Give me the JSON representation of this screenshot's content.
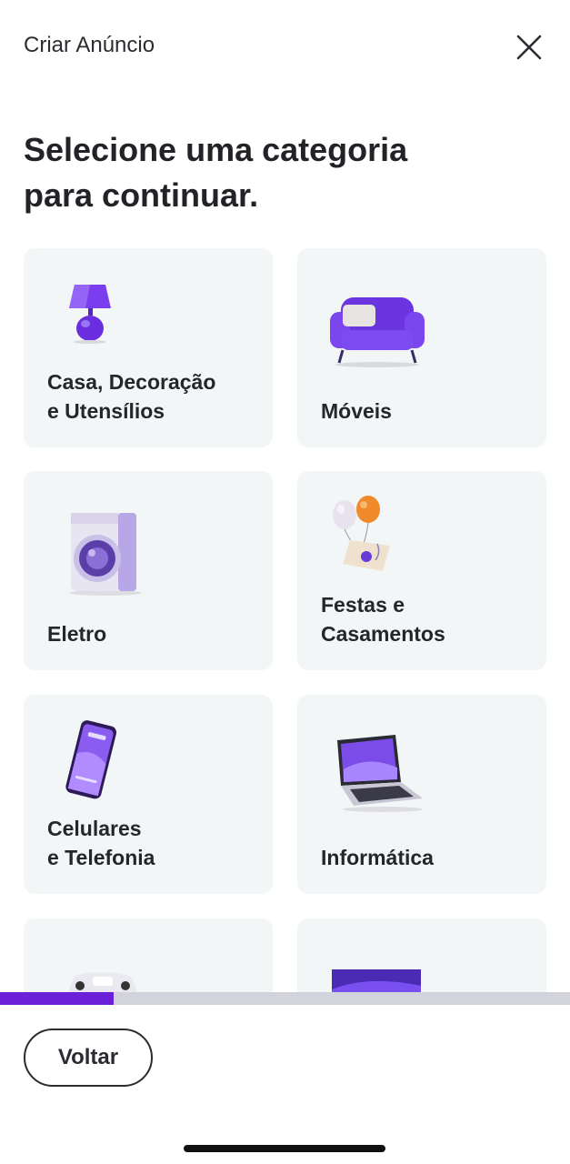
{
  "header": {
    "title": "Criar Anúncio"
  },
  "heading": {
    "line1": "Selecione uma categoria",
    "line2": "para continuar."
  },
  "categories": [
    {
      "line1": "Casa, Decoração",
      "line2": "e Utensílios",
      "icon": "lamp-icon"
    },
    {
      "line1": "Móveis",
      "line2": "",
      "icon": "armchair-icon"
    },
    {
      "line1": "Eletro",
      "line2": "",
      "icon": "washing-machine-icon"
    },
    {
      "line1": "Festas e",
      "line2": "Casamentos",
      "icon": "balloons-icon"
    },
    {
      "line1": "Celulares",
      "line2": "e Telefonia",
      "icon": "smartphone-icon"
    },
    {
      "line1": "Informática",
      "line2": "",
      "icon": "laptop-icon"
    },
    {
      "line1": "",
      "line2": "",
      "icon": "game-controller-icon"
    },
    {
      "line1": "",
      "line2": "",
      "icon": "tv-icon"
    }
  ],
  "progress": {
    "fraction": 0.2
  },
  "footer": {
    "back_label": "Voltar"
  },
  "colors": {
    "accent": "#6b21d8",
    "card_bg": "#f3f6f7",
    "track": "#d3d4db"
  }
}
